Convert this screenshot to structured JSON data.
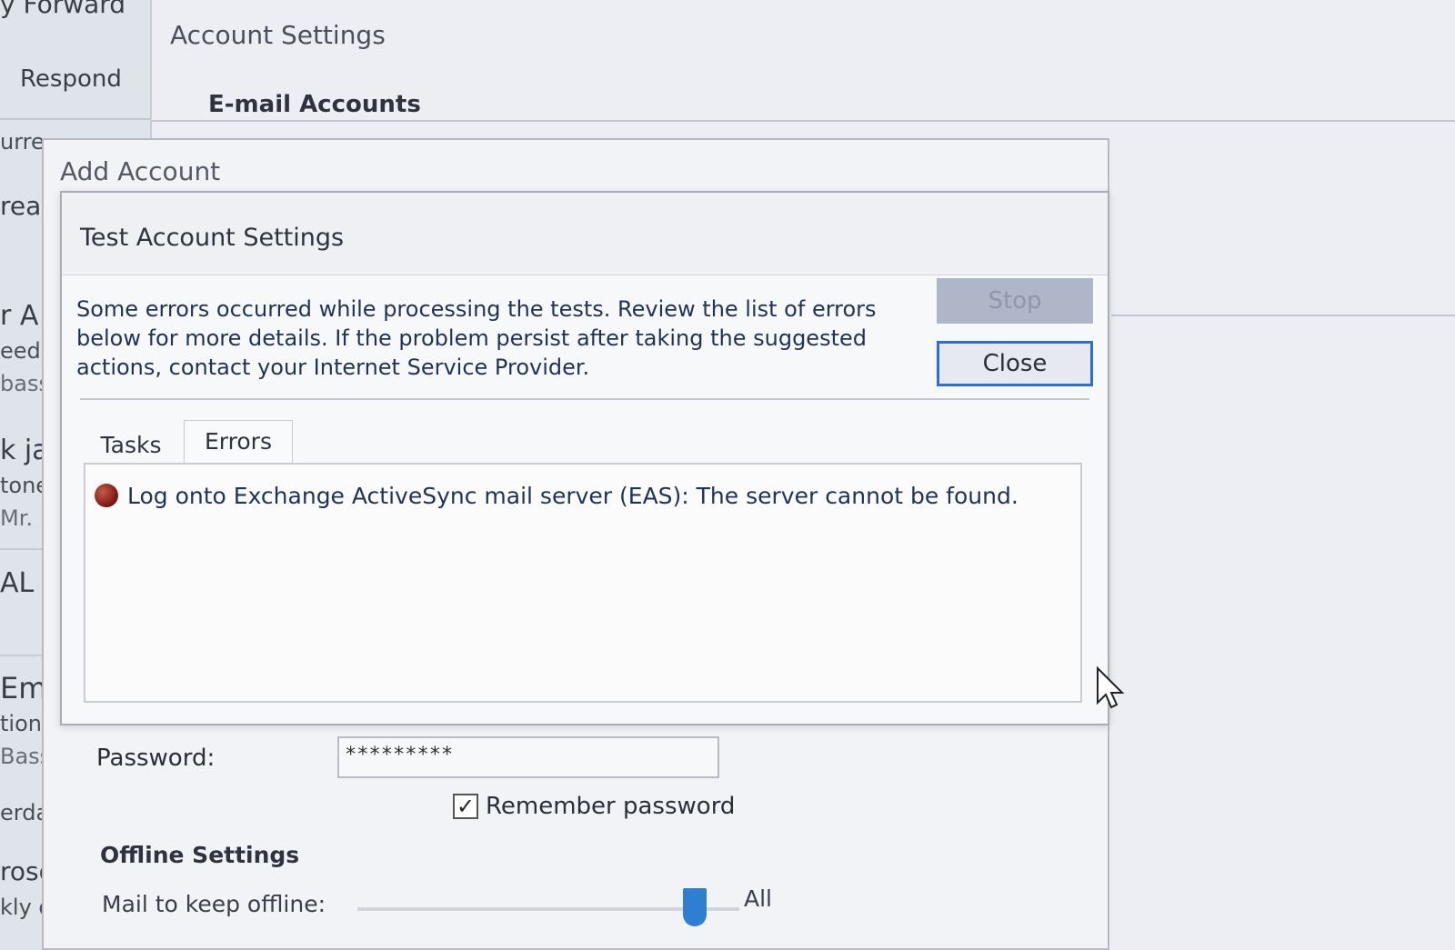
{
  "outlook": {
    "ribbon_forward": "y  Forward",
    "ribbon_respond": "Respond",
    "folder_current_mailbox": "urre",
    "partial_texts": [
      "rea",
      "r A",
      "eed",
      "bass",
      "k jal",
      "tone",
      "Mr. B",
      "AL S",
      "Ema",
      "tiona",
      "Bassa",
      "erday",
      "roso",
      "kly dig"
    ]
  },
  "account_settings": {
    "title": "Account Settings",
    "tab_email_accounts": "E-mail Accounts"
  },
  "add_account": {
    "title": "Add Account",
    "password_label": "Password:",
    "password_value": "*********",
    "remember_password_label": "Remember password",
    "remember_password_checked": true,
    "offline_heading": "Offline Settings",
    "mail_offline_label": "Mail to keep offline:",
    "mail_offline_value": "All"
  },
  "test_dialog": {
    "title": "Test Account Settings",
    "message": "Some errors occurred while processing the tests. Review the list of errors below for more details. If the problem persist after taking the suggested actions, contact your Internet Service Provider.",
    "stop_label": "Stop",
    "close_label": "Close",
    "tabs": [
      {
        "label": "Tasks",
        "active": false
      },
      {
        "label": "Errors",
        "active": true
      }
    ],
    "errors": [
      {
        "icon": "error-icon",
        "text": "Log onto Exchange ActiveSync mail server (EAS): The server cannot be found."
      }
    ]
  },
  "colors": {
    "accent": "#2f6fd3",
    "error": "#8a1c14",
    "message_text": "#1f3358"
  }
}
